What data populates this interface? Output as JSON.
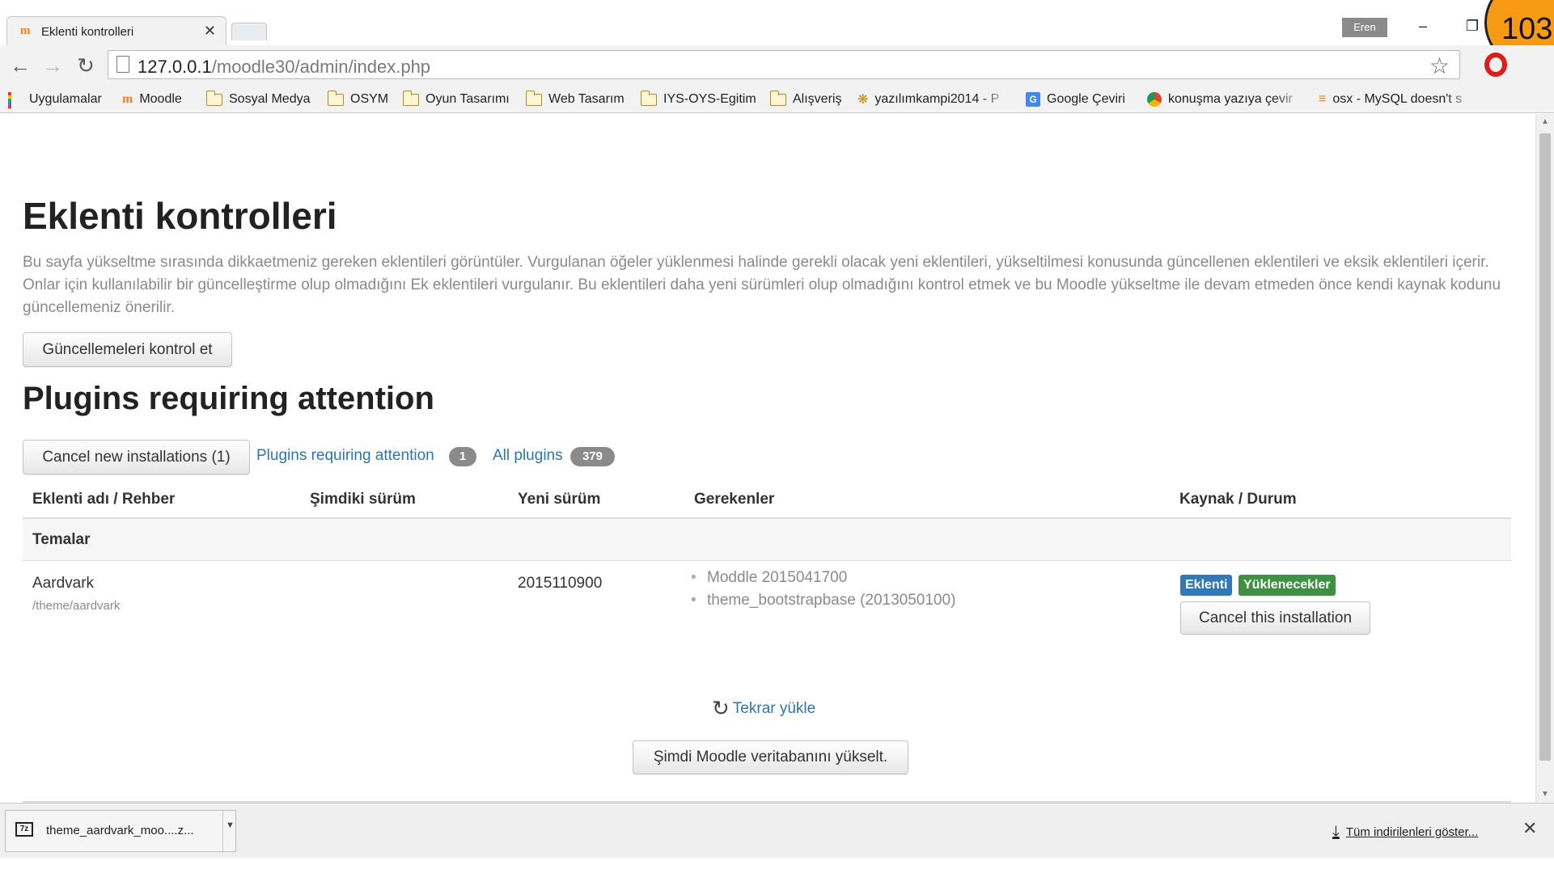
{
  "browser": {
    "tab_title": "Eklenti kontrolleri",
    "tab_favicon": "m",
    "close_glyph": "✕",
    "user_name": "Eren",
    "counter_badge": "103",
    "url_host": "127.0.0.1",
    "url_path": "/moodle30/admin/index.php",
    "bookmarks": [
      {
        "label": "Uygulamalar",
        "icon": "apps-grid-icon"
      },
      {
        "label": "Moodle",
        "icon": "moodle-icon"
      },
      {
        "label": "Sosyal Medya",
        "icon": "folder-icon"
      },
      {
        "label": "OSYM",
        "icon": "folder-icon"
      },
      {
        "label": "Oyun Tasarımı",
        "icon": "folder-icon"
      },
      {
        "label": "Web Tasarım",
        "icon": "folder-icon"
      },
      {
        "label": "IYS-OYS-Egitim",
        "icon": "folder-icon"
      },
      {
        "label": "Alışveriş",
        "icon": "folder-icon"
      },
      {
        "label": "yazılımkampi2014 - P",
        "icon": "tiger-icon"
      },
      {
        "label": "Google Çeviri",
        "icon": "google-translate-icon"
      },
      {
        "label": "konuşma yazıya çevir",
        "icon": "chrome-icon"
      },
      {
        "label": "osx - MySQL doesn't s",
        "icon": "stackoverflow-icon"
      }
    ]
  },
  "page": {
    "title": "Eklenti kontrolleri",
    "intro": "Bu sayfa yükseltme sırasında dikkaetmeniz gereken eklentileri görüntüler. Vurgulanan öğeler yüklenmesi halinde gerekli olacak yeni eklentileri, yükseltilmesi konusunda güncellenen eklentileri ve eksik eklentileri içerir. Onlar için kullanılabilir bir güncelleştirme olup olmadığını Ek eklentileri vurgulanır. Bu eklentileri daha yeni sürümleri olup olmadığını kontrol etmek ve bu Moodle yükseltme ile devam etmeden önce kendi kaynak kodunu güncellemeniz önerilir.",
    "check_updates_button": "Güncellemeleri kontrol et",
    "section_title": "Plugins requiring attention",
    "cancel_new_button": "Cancel new installations (1)",
    "filter_attention_label": "Plugins requiring attention",
    "filter_attention_count": "1",
    "filter_all_label": "All plugins",
    "filter_all_count": "379",
    "table": {
      "headers": [
        "Eklenti adı / Rehber",
        "Şimdiki sürüm",
        "Yeni sürüm",
        "Gerekenler",
        "Kaynak / Durum"
      ],
      "group": "Temalar",
      "rows": [
        {
          "name": "Aardvark",
          "path": "/theme/aardvark",
          "current_version": "",
          "new_version": "2015110900",
          "requirements": [
            "Moddle 2015041700",
            "theme_bootstrapbase (2013050100)"
          ],
          "source_label": "Eklenti",
          "status_label": "Yüklenecekler",
          "cancel_button": "Cancel this installation"
        }
      ]
    },
    "reload_link": "Tekrar yükle",
    "upgrade_button": "Şimdi Moodle veritabanını yükselt."
  },
  "download_shelf": {
    "file_name": "theme_aardvark_moo....z...",
    "file_icon_text": "7z",
    "show_all_label": "Tüm indirilenleri göster...",
    "close_glyph": "✕"
  },
  "colors": {
    "link": "#2b74b8",
    "badge_source": "#2f79b9",
    "badge_status": "#3d9140",
    "counter": "#f79a14"
  }
}
